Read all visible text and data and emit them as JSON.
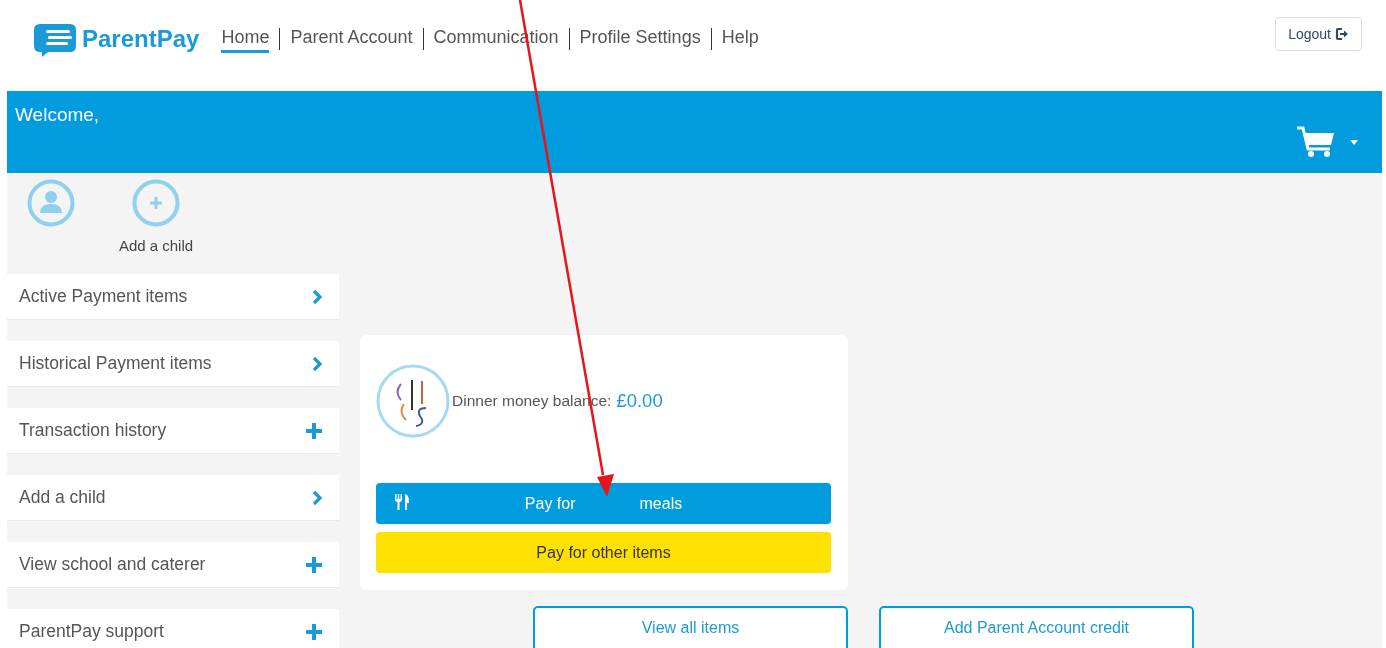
{
  "header": {
    "logo": "ParentPay",
    "nav": [
      {
        "label": "Home",
        "selected": true
      },
      {
        "label": "Parent Account",
        "selected": false
      },
      {
        "label": "Communication",
        "selected": false
      },
      {
        "label": "Profile Settings",
        "selected": false
      },
      {
        "label": "Help",
        "selected": false
      }
    ],
    "logout": "Logout"
  },
  "banner": {
    "welcome": "Welcome,"
  },
  "children": {
    "add_label": "Add a child"
  },
  "sidebar": {
    "items": [
      {
        "label": "Active Payment items",
        "kind": "chevron"
      },
      {
        "label": "Historical Payment items",
        "kind": "chevron"
      },
      {
        "label": "Transaction history",
        "kind": "plus"
      },
      {
        "label": "Add a child",
        "kind": "chevron"
      },
      {
        "label": "View school and caterer",
        "kind": "plus"
      },
      {
        "label": "ParentPay support",
        "kind": "plus"
      }
    ]
  },
  "balance_card": {
    "label": "Dinner money balance:",
    "amount": "£0.00",
    "meals_button": {
      "before": "Pay for",
      "after": "meals"
    },
    "other_button": "Pay for other items"
  },
  "actions": [
    "View all items",
    "Add Parent Account credit"
  ]
}
